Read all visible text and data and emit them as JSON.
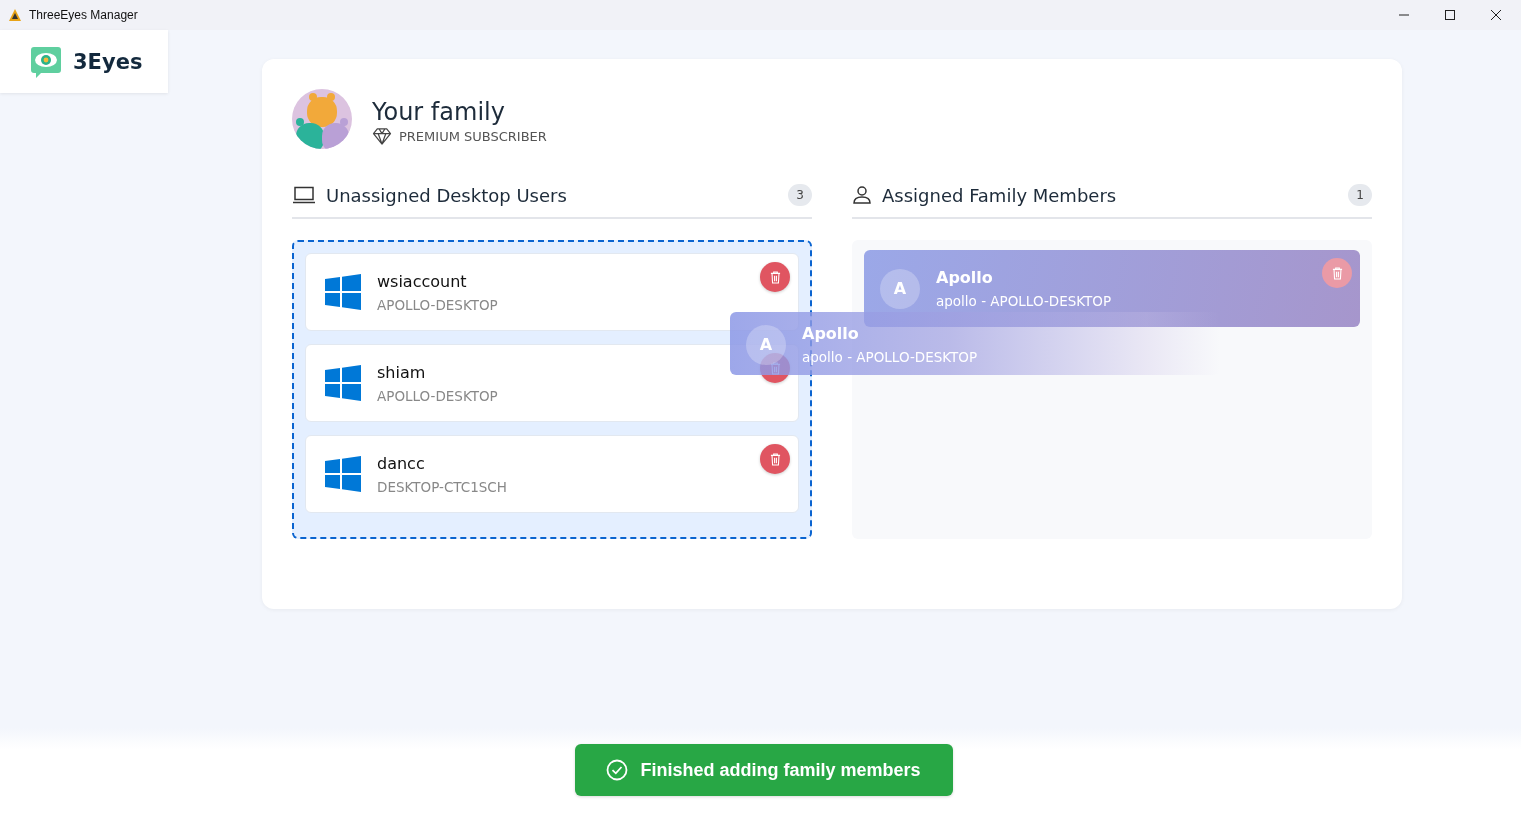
{
  "window": {
    "title": "ThreeEyes Manager"
  },
  "logo": {
    "text": "3Eyes"
  },
  "family": {
    "title": "Your family",
    "subscription": "PREMIUM SUBSCRIBER"
  },
  "unassigned": {
    "title": "Unassigned Desktop Users",
    "count": "3",
    "drop_target": true,
    "users": [
      {
        "kind": "windows",
        "name": "wsiaccount",
        "host": "APOLLO-DESKTOP"
      },
      {
        "kind": "windows",
        "name": "shiam",
        "host": "APOLLO-DESKTOP"
      },
      {
        "kind": "windows",
        "name": "dancc",
        "host": "DESKTOP-CTC1SCH"
      }
    ]
  },
  "assigned": {
    "title": "Assigned Family Members",
    "count": "1",
    "members": [
      {
        "initial": "A",
        "name": "Apollo",
        "detail": "apollo - APOLLO-DESKTOP"
      }
    ]
  },
  "drag_preview": {
    "initial": "A",
    "name": "Apollo",
    "detail": "apollo - APOLLO-DESKTOP"
  },
  "finish_button": {
    "label": "Finished adding family members"
  }
}
